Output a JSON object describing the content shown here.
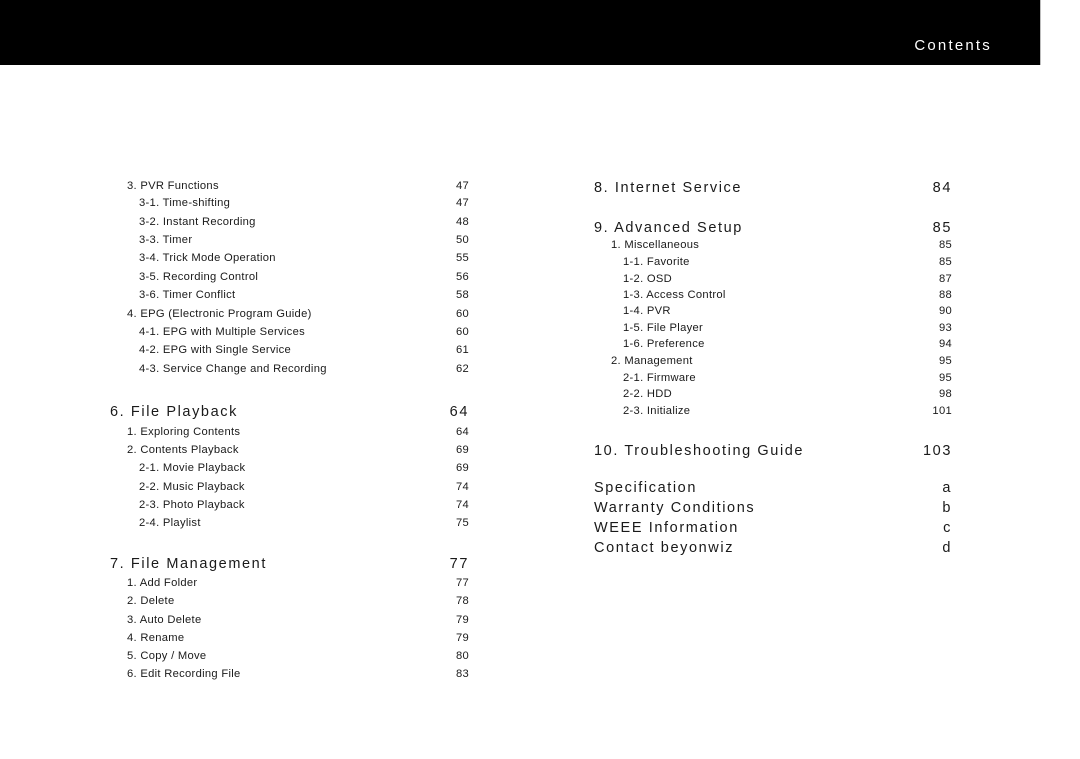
{
  "header": {
    "title": "Contents"
  },
  "left_column": {
    "entries": [
      {
        "level": 1,
        "label": "3. PVR Functions",
        "page": "47"
      },
      {
        "level": 2,
        "label": "3-1. Time-shifting",
        "page": "47"
      },
      {
        "level": 2,
        "label": "3-2. Instant Recording",
        "page": "48"
      },
      {
        "level": 2,
        "label": "3-3. Timer",
        "page": "50"
      },
      {
        "level": 2,
        "label": "3-4. Trick Mode Operation",
        "page": "55"
      },
      {
        "level": 2,
        "label": "3-5. Recording Control",
        "page": "56"
      },
      {
        "level": 2,
        "label": "3-6. Timer Conflict",
        "page": "58"
      },
      {
        "level": 1,
        "label": "4. EPG (Electronic Program Guide)",
        "page": "60"
      },
      {
        "level": 2,
        "label": "4-1. EPG with Multiple Services",
        "page": "60"
      },
      {
        "level": 2,
        "label": "4-2. EPG with Single Service",
        "page": "61"
      },
      {
        "level": 2,
        "label": "4-3. Service Change and Recording",
        "page": "62"
      },
      {
        "level": 0,
        "label": "6. File Playback",
        "page": "64"
      },
      {
        "level": 1,
        "label": "1. Exploring Contents",
        "page": "64"
      },
      {
        "level": 1,
        "label": "2. Contents Playback",
        "page": "69"
      },
      {
        "level": 2,
        "label": "2-1. Movie Playback",
        "page": "69"
      },
      {
        "level": 2,
        "label": "2-2. Music Playback",
        "page": "74"
      },
      {
        "level": 2,
        "label": "2-3. Photo Playback",
        "page": "74"
      },
      {
        "level": 2,
        "label": "2-4. Playlist",
        "page": "75"
      },
      {
        "level": 0,
        "label": "7. File Management",
        "page": "77"
      },
      {
        "level": 1,
        "label": "1. Add Folder",
        "page": "77"
      },
      {
        "level": 1,
        "label": "2. Delete",
        "page": "78"
      },
      {
        "level": 1,
        "label": "3. Auto Delete",
        "page": "79"
      },
      {
        "level": 1,
        "label": "4. Rename",
        "page": "79"
      },
      {
        "level": 1,
        "label": "5. Copy / Move",
        "page": "80"
      },
      {
        "level": 1,
        "label": "6. Edit Recording File",
        "page": "83"
      }
    ]
  },
  "right_column": {
    "entries": [
      {
        "level": 0,
        "label": "8. Internet Service",
        "page": "84"
      },
      {
        "level": 0,
        "label": "9. Advanced Setup",
        "page": "85"
      },
      {
        "level": 1,
        "label": "1. Miscellaneous",
        "page": "85"
      },
      {
        "level": 2,
        "label": "1-1. Favorite",
        "page": "85"
      },
      {
        "level": 2,
        "label": "1-2. OSD",
        "page": "87"
      },
      {
        "level": 2,
        "label": "1-3. Access Control",
        "page": "88"
      },
      {
        "level": 2,
        "label": "1-4. PVR",
        "page": "90"
      },
      {
        "level": 2,
        "label": "1-5. File Player",
        "page": "93"
      },
      {
        "level": 2,
        "label": "1-6. Preference",
        "page": "94"
      },
      {
        "level": 1,
        "label": "2. Management",
        "page": "95"
      },
      {
        "level": 2,
        "label": "2-1. Firmware",
        "page": "95"
      },
      {
        "level": 2,
        "label": "2-2. HDD",
        "page": "98"
      },
      {
        "level": 2,
        "label": "2-3. Initialize",
        "page": "101"
      },
      {
        "level": 0,
        "label": "10. Troubleshooting Guide",
        "page": "103"
      },
      {
        "level": 0,
        "label": "Specification",
        "page": "a"
      },
      {
        "level": 0,
        "label": "Warranty Conditions",
        "page": "b"
      },
      {
        "level": 0,
        "label": "WEEE Information",
        "page": "c"
      },
      {
        "level": 0,
        "label": "Contact beyonwiz",
        "page": "d"
      }
    ]
  }
}
